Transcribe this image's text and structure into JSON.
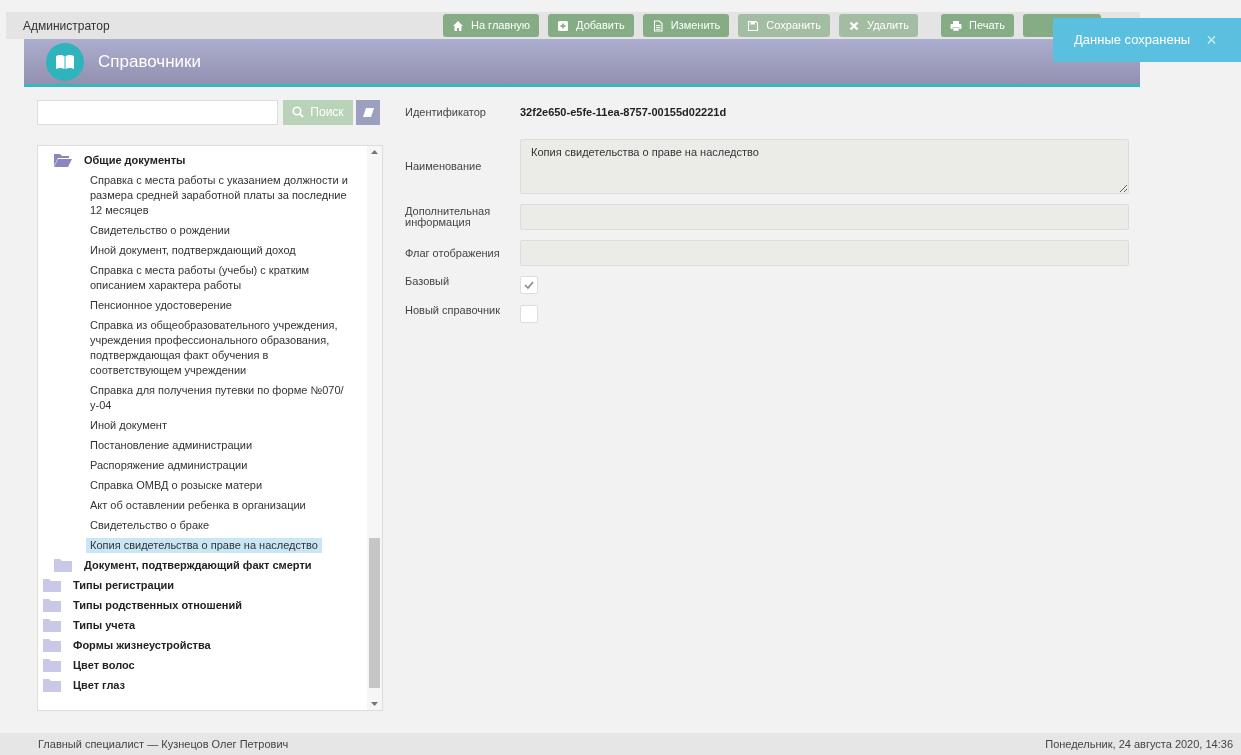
{
  "top_bar": {
    "user_role": "Администратор",
    "buttons": [
      {
        "label": "На главную",
        "disabled": false
      },
      {
        "label": "Добавить",
        "disabled": false
      },
      {
        "label": "Изменить",
        "disabled": false
      },
      {
        "label": "Сохранить",
        "disabled": true
      },
      {
        "label": "Удалить",
        "disabled": true
      },
      {
        "label": "Печать",
        "disabled": false
      },
      {
        "disabled": false
      }
    ]
  },
  "header": {
    "title": "Справочники"
  },
  "toast": {
    "message": "Данные сохранены",
    "close": "×"
  },
  "search": {
    "button": "Поиск"
  },
  "tree": [
    {
      "label": "Общие документы",
      "kind": "folder",
      "expanded": true,
      "children": [
        {
          "label": "Справка с места работы с указанием должности и размера средней заработной платы за последние 12 месяцев",
          "kind": "leaf",
          "selected": false
        },
        {
          "label": "Свидетельство о рождении",
          "kind": "leaf",
          "selected": false
        },
        {
          "label": "Иной документ, подтверждающий доход",
          "kind": "leaf",
          "selected": false
        },
        {
          "label": "Справка с места работы (учебы) с кратким описанием характера работы",
          "kind": "leaf",
          "selected": false
        },
        {
          "label": "Пенсионное удостоверение",
          "kind": "leaf",
          "selected": false
        },
        {
          "label": "Справка из общеобразовательного учреждения, учреждения профессионального образования, подтверждающая факт обучения в соответствующем учреждении",
          "kind": "leaf",
          "selected": false
        },
        {
          "label": "Справка для получения путевки по форме №070/у-04",
          "kind": "leaf",
          "selected": false
        },
        {
          "label": "Иной документ",
          "kind": "leaf",
          "selected": false
        },
        {
          "label": "Постановление администрации",
          "kind": "leaf",
          "selected": false
        },
        {
          "label": "Распоряжение администрации",
          "kind": "leaf",
          "selected": false
        },
        {
          "label": "Справка ОМВД о розыске матери",
          "kind": "leaf",
          "selected": false
        },
        {
          "label": "Акт об оставлении ребенка в организации",
          "kind": "leaf",
          "selected": false
        },
        {
          "label": "Свидетельство о браке",
          "kind": "leaf",
          "selected": false
        },
        {
          "label": "Копия свидетельства о праве на наследство",
          "kind": "leaf",
          "selected": true
        }
      ]
    },
    {
      "label": "Документ, подтверждающий факт смерти",
      "kind": "folder",
      "expanded": false
    }
  ],
  "root_folders": [
    {
      "label": "Типы регистрации",
      "kind": "folder",
      "expanded": false
    },
    {
      "label": "Типы родственных отношений",
      "kind": "folder",
      "expanded": false
    },
    {
      "label": "Типы учета",
      "kind": "folder",
      "expanded": false
    },
    {
      "label": "Формы жизнеустройства",
      "kind": "folder",
      "expanded": false
    },
    {
      "label": "Цвет волос",
      "kind": "folder",
      "expanded": false
    },
    {
      "label": "Цвет глаз",
      "kind": "folder",
      "expanded": false
    }
  ],
  "form": [
    {
      "label": "Идентификатор",
      "kind": "text",
      "value": "32f2e650-e5fe-11ea-8757-00155d02221d"
    },
    {
      "label": "Наименование",
      "kind": "textarea",
      "value": "Копия свидетельства о праве на наследство"
    },
    {
      "label": "Дополнительная информация",
      "kind": "input"
    },
    {
      "label": "Флаг отображения",
      "kind": "input"
    },
    {
      "label": "Базовый",
      "kind": "checkbox",
      "checked": true
    },
    {
      "label": "Новый справочник",
      "kind": "checkbox",
      "checked": false
    }
  ],
  "status_bar": {
    "user": "Главный специалист — Кузнецов Олег Петрович",
    "datetime": "Понедельник, 24 августа 2020, 14:36"
  }
}
